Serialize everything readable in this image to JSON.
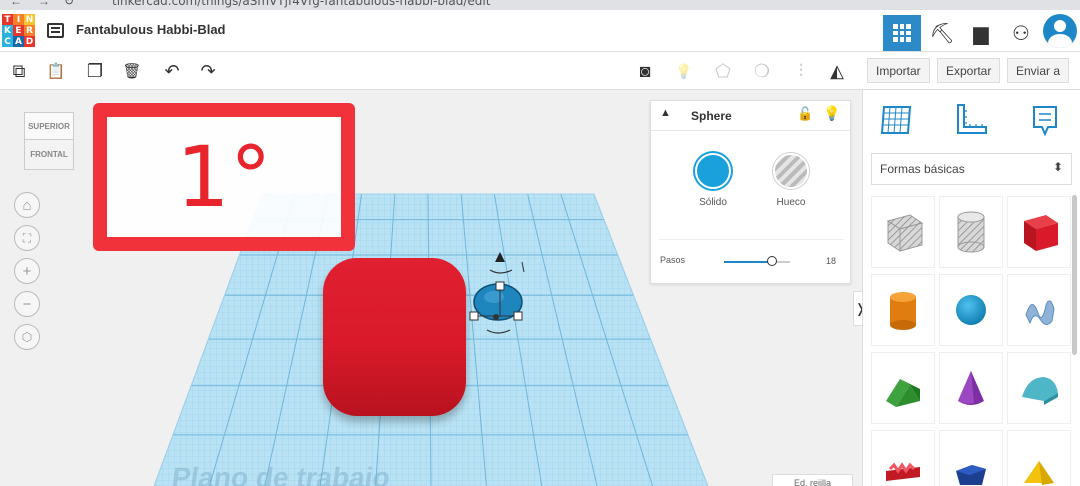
{
  "browser": {
    "url": "tinkercad.com/things/aSmVTjf4Vfg-fantabulous-habbi-blad/edit"
  },
  "app": {
    "logo_letters": [
      "T",
      "I",
      "N",
      "K",
      "E",
      "R",
      "C",
      "A",
      "D"
    ],
    "logo_colors": [
      "#e8352b",
      "#f48127",
      "#f7c331",
      "#2bb1dd",
      "#e8352b",
      "#f48127",
      "#2bb1dd",
      "#1c67a8",
      "#e8352b"
    ],
    "design_title": "Fantabulous Habbi-Blad"
  },
  "header": {
    "views": [
      {
        "name": "3d-design",
        "glyph": ""
      },
      {
        "name": "codeblocks",
        "glyph": "⛏"
      },
      {
        "name": "bricks",
        "glyph": "▆"
      }
    ],
    "add_user_glyph": "⚇",
    "accent": "#2d8ac9"
  },
  "toolbar": {
    "tools": [
      {
        "name": "copy",
        "glyph": "⧉"
      },
      {
        "name": "paste",
        "glyph": "📋"
      },
      {
        "name": "duplicate",
        "glyph": "❐"
      },
      {
        "name": "delete",
        "glyph": "🗑"
      },
      {
        "name": "undo",
        "glyph": "↶"
      },
      {
        "name": "redo",
        "glyph": "↷"
      }
    ],
    "right_tools": [
      {
        "name": "notes",
        "glyph": "◙",
        "disabled": false
      },
      {
        "name": "light",
        "glyph": "💡",
        "disabled": true
      },
      {
        "name": "shape-tag",
        "glyph": "⬠",
        "disabled": true
      },
      {
        "name": "group",
        "glyph": "❍",
        "disabled": true
      },
      {
        "name": "align",
        "glyph": "⫶",
        "disabled": true
      },
      {
        "name": "mirror",
        "glyph": "◭",
        "disabled": false
      }
    ],
    "import_label": "Importar",
    "export_label": "Exportar",
    "send_label": "Enviar a"
  },
  "viewcube": {
    "top_label": "SUPERIOR",
    "front_label": "FRONTAL"
  },
  "workspace": {
    "workplane_label": "Plano de trabajo",
    "grid_edit_label": "Ed. rejilla",
    "annotation_text": "1°",
    "annotation_color": "#f1323a"
  },
  "inspector": {
    "title": "Sphere",
    "solid_label": "Sólido",
    "hole_label": "Hueco",
    "steps_label": "Pasos",
    "steps_value": "18",
    "steps_fraction": 0.72,
    "solid_color": "#1aa1dc"
  },
  "shapes_panel": {
    "category": "Formas básicas",
    "shapes": [
      "box-hole",
      "cylinder-hole",
      "box",
      "cylinder",
      "sphere",
      "scribble",
      "roof",
      "cone",
      "round-roof",
      "text",
      "polygon",
      "pyramid"
    ]
  }
}
